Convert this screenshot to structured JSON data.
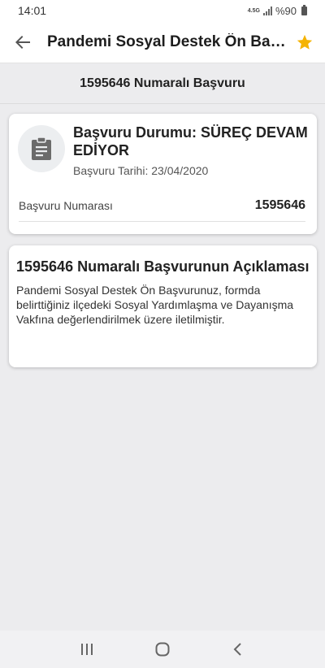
{
  "status_bar": {
    "time": "14:01",
    "network": "4.5G",
    "battery": "%90"
  },
  "app_bar": {
    "title": "Pandemi Sosyal Destek Ön Başvurusu",
    "back_icon": "arrow-left-icon",
    "favorite_icon": "star-icon",
    "favorite_color": "#f5b301"
  },
  "subheader": {
    "title": "1595646 Numaralı Başvuru"
  },
  "status_card": {
    "icon": "clipboard-icon",
    "heading": "Başvuru Durumu: SÜREÇ DEVAM EDİYOR",
    "date": "Başvuru Tarihi: 23/04/2020",
    "number_label": "Başvuru Numarası",
    "number_value": "1595646"
  },
  "description_card": {
    "title": "1595646 Numaralı Başvurunun Açıklaması",
    "body": "Pandemi Sosyal Destek Ön Başvurunuz, formda belirttiğiniz ilçedeki Sosyal Yardımlaşma ve Dayanışma Vakfına değerlendirilmek üzere iletilmiştir."
  },
  "nav_bar": {
    "recents_icon": "recents-icon",
    "home_icon": "home-icon",
    "back_icon": "nav-back-icon"
  }
}
